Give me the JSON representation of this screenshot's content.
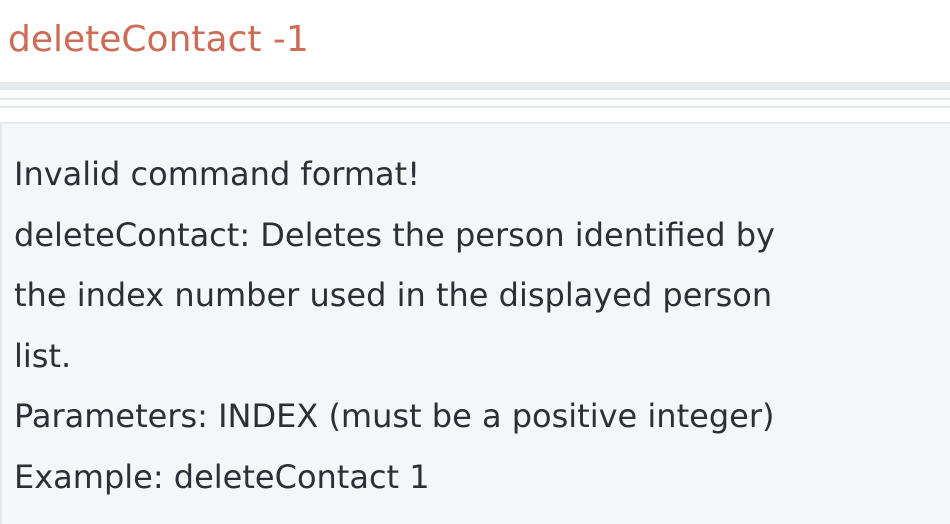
{
  "command": {
    "input_value": "deleteContact -1"
  },
  "result": {
    "lines": [
      "Invalid command format!",
      "deleteContact: Deletes the person identified by",
      "the index number used in the displayed person",
      "list.",
      "Parameters: INDEX (must be a positive integer)",
      "Example: deleteContact 1"
    ]
  },
  "colors": {
    "command_text": "#cd6b55",
    "result_background": "#f4f6f9",
    "divider": "#e4e9ee",
    "result_text": "#2b2f36"
  }
}
